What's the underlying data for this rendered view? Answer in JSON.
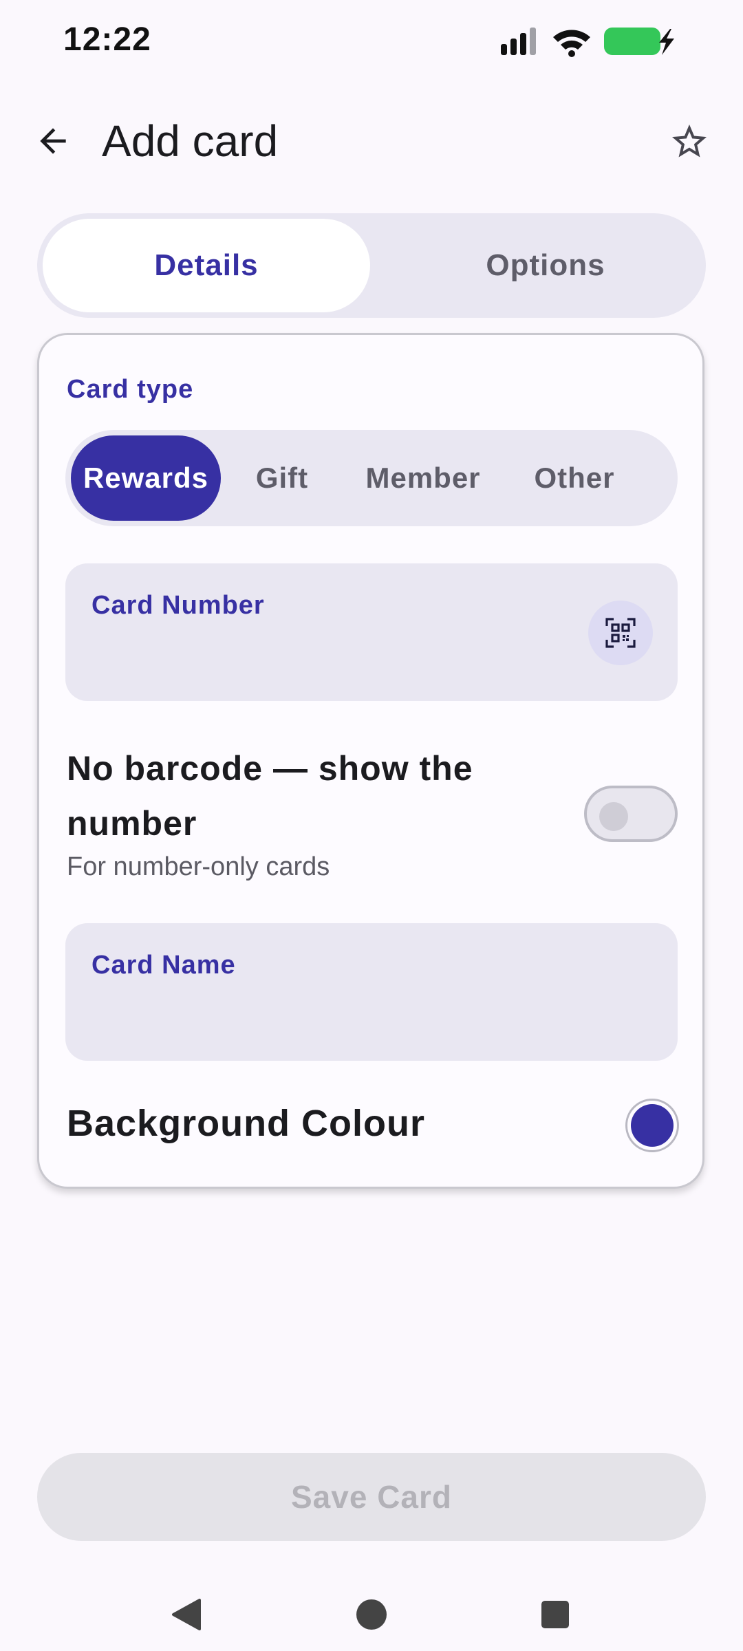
{
  "status_bar": {
    "time": "12:22",
    "battery_color": "#34C759"
  },
  "app_bar": {
    "title": "Add card",
    "back_icon": "arrow-left-icon",
    "favorite_icon": "star-outline-icon"
  },
  "tabs": [
    {
      "label": "Details",
      "selected": true
    },
    {
      "label": "Options",
      "selected": false
    }
  ],
  "card_type": {
    "label": "Card type",
    "options": [
      "Rewards",
      "Gift",
      "Member",
      "Other"
    ],
    "selected": "Rewards"
  },
  "card_number": {
    "label": "Card Number",
    "value": "",
    "scan_icon": "qr-scan-icon"
  },
  "no_barcode": {
    "title": "No barcode — show the number",
    "subtitle": "For number-only cards",
    "enabled": false
  },
  "card_name": {
    "label": "Card Name",
    "value": ""
  },
  "background_colour": {
    "label": "Background Colour",
    "value": "#3730A3"
  },
  "save_button": {
    "label": "Save Card",
    "enabled": false
  },
  "colors": {
    "accent": "#3730A3",
    "background": "#FBF8FD",
    "surface_variant": "#E9E7F2"
  }
}
